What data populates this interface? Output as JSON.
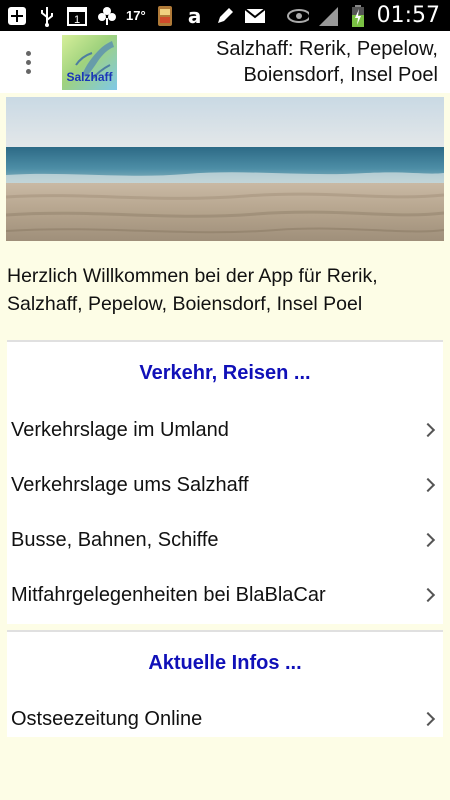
{
  "status_bar": {
    "icons_left": [
      "add-icon",
      "usb-icon",
      "calendar-icon",
      "weather-icon",
      "temperature",
      "fridge-icon",
      "amazon-icon",
      "pencil-icon",
      "mail-icon"
    ],
    "temperature": "17°",
    "calendar_day": "1",
    "amazon_glyph": "a",
    "icons_right": [
      "eye-icon",
      "signal-icon",
      "battery-icon"
    ],
    "time": "01:57"
  },
  "action_bar": {
    "logo_text": "Salzhaff",
    "title": "Salzhaff: Rerik, Pepelow, Boiensdorf, Insel Poel"
  },
  "welcome_text": "Herzlich Willkommen bei der App für Rerik, Salzhaff, Pepelow, Boiensdorf, Insel Poel",
  "sections": [
    {
      "title": "Verkehr, Reisen ...",
      "items": [
        {
          "label": "Verkehrslage im Umland"
        },
        {
          "label": "Verkehrslage ums Salzhaff"
        },
        {
          "label": "Busse, Bahnen, Schiffe"
        },
        {
          "label": "Mitfahrgelegenheiten bei BlaBlaCar"
        }
      ]
    },
    {
      "title": "Aktuelle Infos ...",
      "items": [
        {
          "label": "Ostseezeitung Online"
        }
      ]
    }
  ],
  "colors": {
    "background": "#fdfde6",
    "section_title": "#1010b8",
    "status_bar": "#000000"
  }
}
